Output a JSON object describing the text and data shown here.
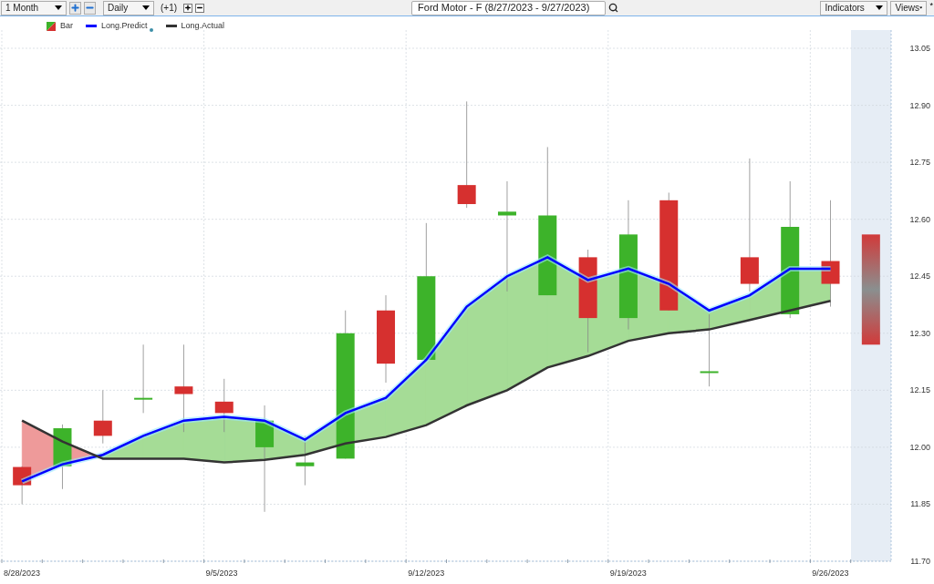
{
  "toolbar": {
    "period": {
      "value": "1 Month"
    },
    "interval": {
      "value": "Daily"
    },
    "offset": "(+1)",
    "title": "Ford Motor - F (8/27/2023 - 9/27/2023)",
    "indicators": "Indicators",
    "views": "Views",
    "marker": "*"
  },
  "chart": {
    "chart_data": {
      "type": "line",
      "grid": true,
      "categories": [
        "8/28/2023",
        null,
        null,
        null,
        null,
        "9/5/2023",
        null,
        null,
        null,
        null,
        "9/12/2023",
        null,
        null,
        null,
        null,
        "9/19/2023",
        null,
        null,
        null,
        null,
        "9/26/2023",
        null
      ],
      "ylim": [
        11.7,
        13.05
      ],
      "yticks": [
        {
          "value": 13.05,
          "label": "13.05"
        },
        {
          "value": 12.9,
          "label": "12.90"
        },
        {
          "value": 12.75,
          "label": "12.75"
        },
        {
          "value": 12.6,
          "label": "12.60"
        },
        {
          "value": 12.45,
          "label": "12.45"
        },
        {
          "value": 12.3,
          "label": "12.30"
        },
        {
          "value": 12.15,
          "label": "12.15"
        },
        {
          "value": 12.0,
          "label": "12.00"
        },
        {
          "value": 11.85,
          "label": "11.85"
        },
        {
          "value": 11.7,
          "label": "11.70"
        }
      ],
      "series": [
        {
          "name": "Bar",
          "type": "bar",
          "colors": [
            "#d6302f",
            "#3db32a",
            "#d6302f",
            "#3db32a",
            "#d6302f",
            "#d6302f",
            "#3db32a",
            "#3db32a",
            "#3db32a",
            "#d6302f",
            "#3db32a",
            "#d6302f",
            "#3db32a",
            "#3db32a",
            "#d6302f",
            "#3db32a",
            "#d6302f",
            "#3db32a",
            "#d6302f",
            "#3db32a",
            "#d6302f",
            "#d13a3a"
          ],
          "base": [
            11.948,
            11.95,
            12.07,
            12.13,
            12.16,
            12.12,
            12.0,
            11.95,
            11.97,
            12.36,
            12.23,
            12.69,
            12.61,
            12.4,
            12.5,
            12.34,
            12.65,
            12.2,
            12.5,
            12.35,
            12.49,
            12.56
          ],
          "errors": [
            [
              11.85,
              11.95
            ],
            [
              11.89,
              12.06
            ],
            [
              12.01,
              12.15
            ],
            [
              12.09,
              12.27
            ],
            [
              12.04,
              12.27
            ],
            [
              12.04,
              12.18
            ],
            [
              11.83,
              12.11
            ],
            [
              11.9,
              12.03
            ],
            [
              11.97,
              12.36
            ],
            [
              12.17,
              12.4
            ],
            [
              12.23,
              12.59
            ],
            [
              12.63,
              12.91
            ],
            [
              12.41,
              12.7
            ],
            [
              12.4,
              12.79
            ],
            [
              12.25,
              12.52
            ],
            [
              12.31,
              12.65
            ],
            [
              12.36,
              12.67
            ],
            [
              12.16,
              12.35
            ],
            [
              12.41,
              12.76
            ],
            [
              12.34,
              12.7
            ],
            [
              12.37,
              12.65
            ],
            null
          ],
          "values": [
            -0.048,
            0.1,
            -0.04,
            0,
            -0.02,
            -0.03,
            0.07,
            0.01,
            0.33,
            -0.14,
            0.22,
            -0.05,
            0.01,
            0.21,
            -0.16,
            0.22,
            -0.29,
            0,
            -0.07,
            0.23,
            -0.06,
            -0.29
          ]
        },
        {
          "name": "Long.Predict",
          "color": "#0000ff",
          "values": [
            11.91,
            11.955,
            11.98,
            12.03,
            12.07,
            12.08,
            12.07,
            12.02,
            12.09,
            12.13,
            12.23,
            12.37,
            12.45,
            12.5,
            12.44,
            12.47,
            12.43,
            12.36,
            12.4,
            12.47,
            12.47,
            null
          ]
        },
        {
          "name": "Long.Actual",
          "color": "#333333",
          "values": [
            12.07,
            12.015,
            11.97,
            11.97,
            11.97,
            11.96,
            11.967,
            11.98,
            12.01,
            12.027,
            12.058,
            12.11,
            12.15,
            12.21,
            12.24,
            12.28,
            12.3,
            12.31,
            12.335,
            12.36,
            12.385,
            null
          ]
        }
      ]
    }
  }
}
